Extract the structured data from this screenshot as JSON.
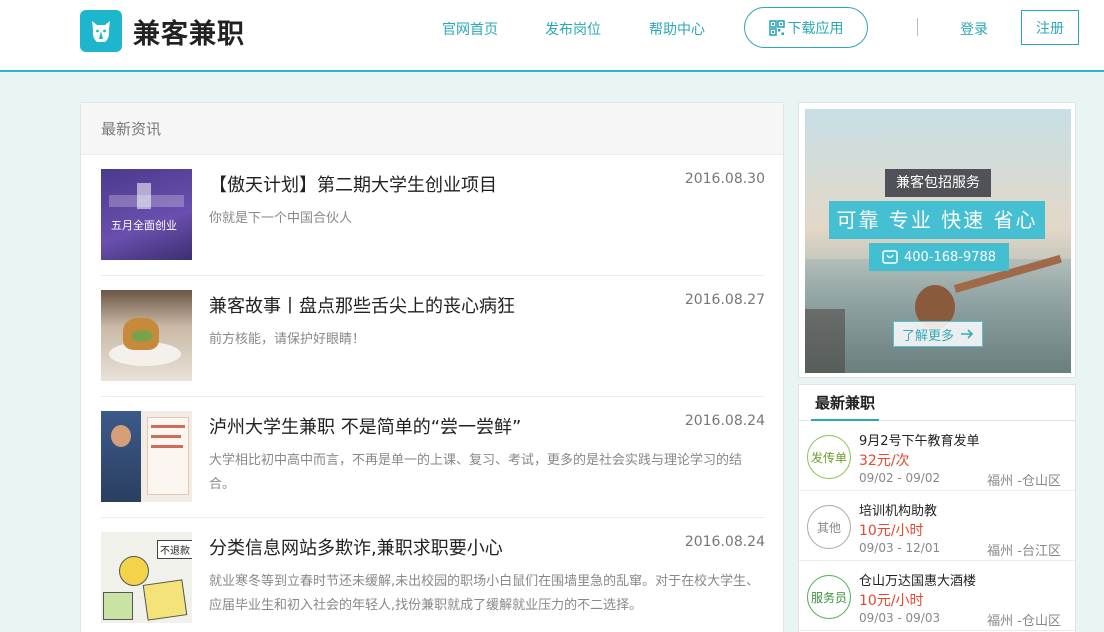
{
  "header": {
    "logo_text": "兼客兼职",
    "nav": [
      "官网首页",
      "发布岗位",
      "帮助中心"
    ],
    "download_label": "下载应用",
    "login_label": "登录",
    "register_label": "注册",
    "accent_color": "#2aa8b8"
  },
  "news": {
    "section_title": "最新资讯",
    "items": [
      {
        "title": "【傲天计划】第二期大学生创业项目",
        "date": "2016.08.30",
        "desc": "你就是下一个中国合伙人",
        "thumb_text": "五月全面创业"
      },
      {
        "title": "兼客故事丨盘点那些舌尖上的丧心病狂",
        "date": "2016.08.27",
        "desc": "前方核能，请保护好眼睛！"
      },
      {
        "title": "泸州大学生兼职 不是简单的“尝一尝鲜”",
        "date": "2016.08.24",
        "desc": "大学相比初中高中而言，不再是单一的上课、复习、考试，更多的是社会实践与理论学习的结合。"
      },
      {
        "title": "分类信息网站多欺诈,兼职求职要小心",
        "date": "2016.08.24",
        "desc": "就业寒冬等到立春时节还未缓解,未出校园的职场小白鼠们在围墙里急的乱窜。对于在校大学生、应届毕业生和初入社会的年轻人,找份兼职就成了缓解就业压力的不二选择。",
        "thumb_text": "不退款"
      }
    ]
  },
  "ad": {
    "badge": "兼客包招服务",
    "slogan": "可靠 专业 快速 省心",
    "phone": "400-168-9788",
    "more_label": "了解更多"
  },
  "jobs": {
    "section_title": "最新兼职",
    "items": [
      {
        "badge": "发传单",
        "badge_color": "#8bc34a",
        "name": "9月2号下午教育发单",
        "pay": "32元/次",
        "dates": "09/02 - 09/02",
        "location": "福州 -仓山区"
      },
      {
        "badge": "其他",
        "badge_color": "#aaaaaa",
        "name": "培训机构助教",
        "pay": "10元/小时",
        "dates": "09/03 - 12/01",
        "location": "福州 -台江区"
      },
      {
        "badge": "服务员",
        "badge_color": "#4caf50",
        "name": "仓山万达国惠大酒楼",
        "pay": "10元/小时",
        "dates": "09/03 - 09/03",
        "location": "福州 -仓山区"
      }
    ]
  }
}
